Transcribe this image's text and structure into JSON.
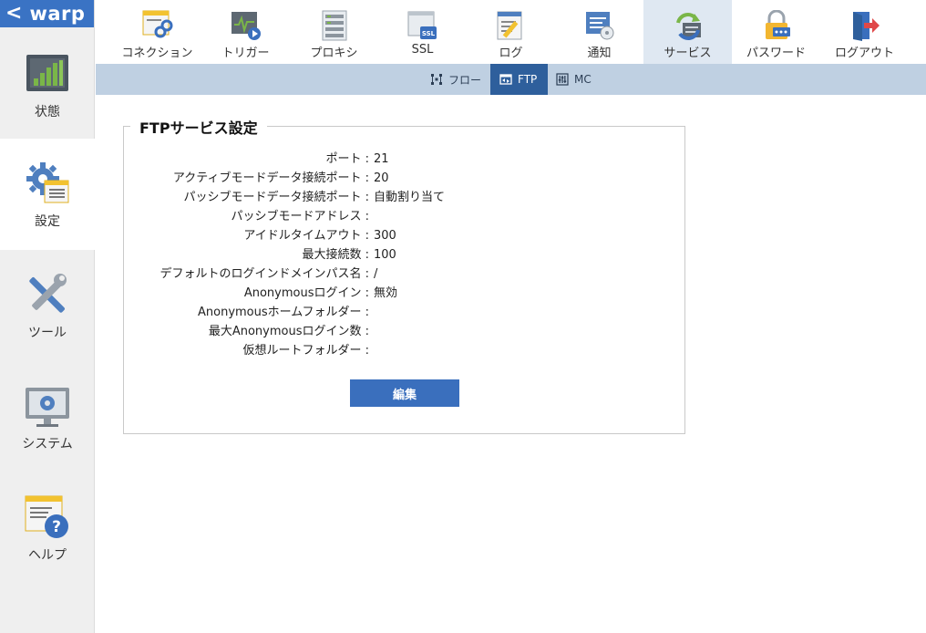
{
  "brand": {
    "back_glyph": "<",
    "name": "warp"
  },
  "sidebar": {
    "items": [
      {
        "label": "状態",
        "icon": "status-chart-icon",
        "active": false
      },
      {
        "label": "設定",
        "icon": "settings-gear-icon",
        "active": true
      },
      {
        "label": "ツール",
        "icon": "tools-icon",
        "active": false
      },
      {
        "label": "システム",
        "icon": "system-monitor-icon",
        "active": false
      },
      {
        "label": "ヘルプ",
        "icon": "help-icon",
        "active": false
      }
    ]
  },
  "topnav": {
    "items": [
      {
        "label": "コネクション",
        "icon": "connection-icon"
      },
      {
        "label": "トリガー",
        "icon": "trigger-icon"
      },
      {
        "label": "プロキシ",
        "icon": "proxy-icon"
      },
      {
        "label": "SSL",
        "icon": "ssl-icon"
      },
      {
        "label": "ログ",
        "icon": "log-icon"
      },
      {
        "label": "通知",
        "icon": "notify-icon"
      },
      {
        "label": "サービス",
        "icon": "service-icon",
        "active": true
      },
      {
        "label": "パスワード",
        "icon": "password-lock-icon"
      },
      {
        "label": "ログアウト",
        "icon": "logout-icon"
      }
    ]
  },
  "subnav": {
    "items": [
      {
        "label": "フロー",
        "icon": "flow-icon"
      },
      {
        "label": "FTP",
        "icon": "ftp-icon",
        "active": true
      },
      {
        "label": "MC",
        "icon": "mc-icon"
      }
    ]
  },
  "panel": {
    "title": "FTPサービス設定",
    "rows": [
      {
        "key": "ポート :",
        "value": "21"
      },
      {
        "key": "アクティブモードデータ接続ポート :",
        "value": "20"
      },
      {
        "key": "パッシブモードデータ接続ポート :",
        "value": "自動割り当て"
      },
      {
        "key": "パッシブモードアドレス :",
        "value": ""
      },
      {
        "key": "アイドルタイムアウト :",
        "value": "300"
      },
      {
        "key": "最大接続数 :",
        "value": "100"
      },
      {
        "key": "デフォルトのログインドメインパス名 :",
        "value": "/"
      },
      {
        "key": "Anonymousログイン :",
        "value": "無効"
      },
      {
        "key": "Anonymousホームフォルダー :",
        "value": ""
      },
      {
        "key": "最大Anonymousログイン数 :",
        "value": ""
      },
      {
        "key": "仮想ルートフォルダー :",
        "value": ""
      }
    ],
    "edit_label": "編集"
  },
  "colors": {
    "accent": "#3a73c4",
    "subbar": "#bfd0e2",
    "subbar_active": "#2e5f9c",
    "top_active": "#dfe8f2"
  }
}
